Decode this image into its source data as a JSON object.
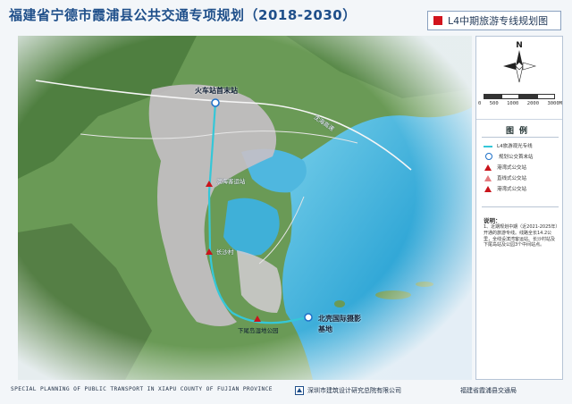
{
  "header": {
    "title": "福建省宁德市霞浦县公共交通专项规划（2018-2030）",
    "subtitle": "L4中期旅游专线规划图"
  },
  "legend": {
    "title": "图例",
    "items": [
      {
        "label": "L4旅游观光专线",
        "symbol": "cyan-line",
        "color": "#35c7d8"
      },
      {
        "label": "规划公交首末站",
        "symbol": "blue-circle",
        "color": "#1e70c8"
      },
      {
        "label": "港湾式公交站",
        "symbol": "red-triangle",
        "color": "#c9141b"
      },
      {
        "label": "直线式公交站",
        "symbol": "red-triangle-outline",
        "color": "#c9141b"
      },
      {
        "label": "港湾式公交站",
        "symbol": "red-triangle",
        "color": "#c9141b"
      }
    ]
  },
  "scale": {
    "labels": [
      "0",
      "500",
      "1000",
      "2000",
      "3000M"
    ]
  },
  "notes": {
    "title": "说明：",
    "text": "1、近期规划中期（近2021-2025年）开通的旅游专线。线路全长14.2公里，全线设滨湾客运站、长沙村站及下尾岛站及公园3个中间站点。"
  },
  "map": {
    "labels": {
      "start_station": "火车站首末站",
      "stop1": "滨海客运站",
      "stop2": "长沙村",
      "stop3": "下尾岛湿地公园",
      "end_station": "北壳国际摄影",
      "end_station_2": "基地",
      "expressway": "沈海高速"
    }
  },
  "footer": {
    "english": "SPECIAL PLANNING OF PUBLIC TRANSPORT IN XIAPU COUNTY OF FUJIAN PROVINCE",
    "org": "深圳市建筑设计研究总院有限公司",
    "client": "福建省霞浦县交通局"
  },
  "colors": {
    "route": "#35c7d8",
    "sea": "#3fb0d8",
    "land": "#5e8f4c",
    "urban": "#c9c2c8",
    "title": "#1f4f8a",
    "stop": "#c9141b"
  }
}
